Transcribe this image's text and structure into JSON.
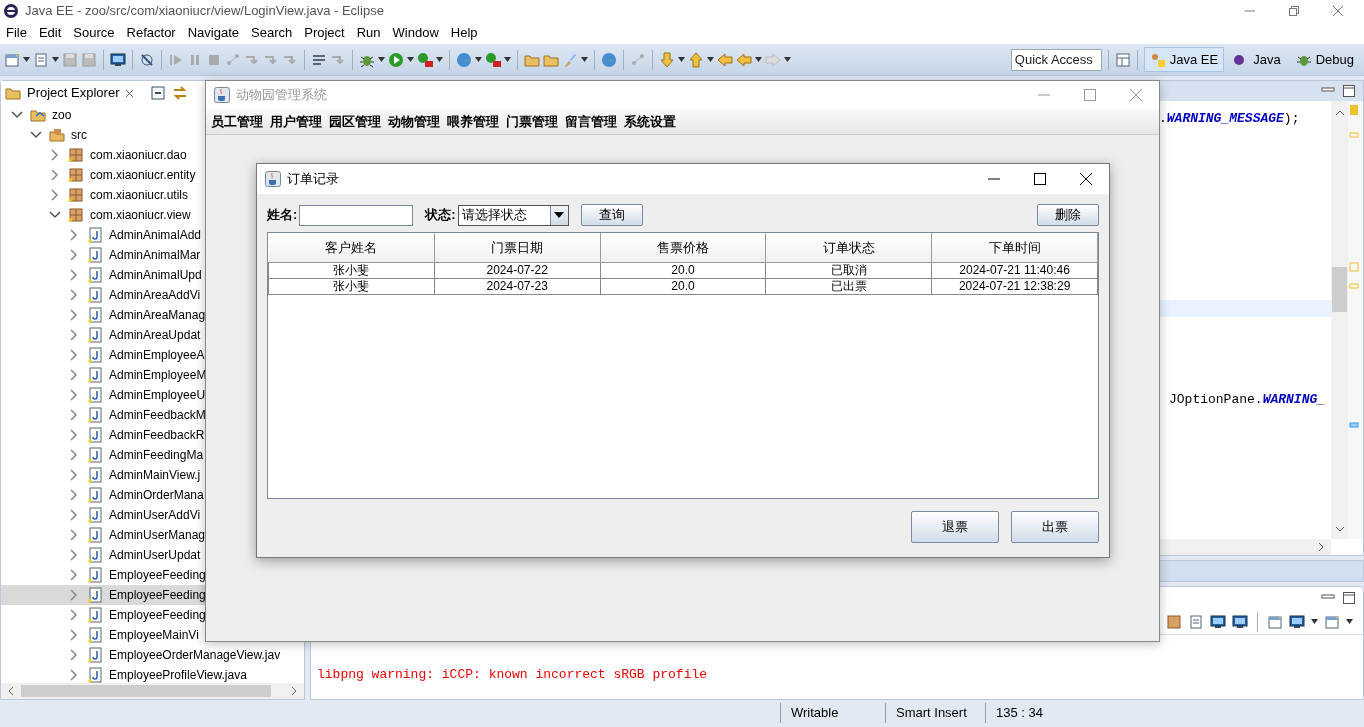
{
  "window": {
    "title": "Java EE - zoo/src/com/xiaoniucr/view/LoginView.java - Eclipse"
  },
  "menu": [
    "File",
    "Edit",
    "Source",
    "Refactor",
    "Navigate",
    "Search",
    "Project",
    "Run",
    "Window",
    "Help"
  ],
  "quick_access": {
    "placeholder": "Quick Access"
  },
  "perspectives": [
    {
      "label": "Java EE",
      "selected": true
    },
    {
      "label": "Java",
      "selected": false
    },
    {
      "label": "Debug",
      "selected": false
    }
  ],
  "project_explorer": {
    "title": "Project Explorer",
    "tree": [
      {
        "kind": "project",
        "label": "zoo",
        "expanded": true,
        "selected": false,
        "children": [
          {
            "kind": "source",
            "label": "src",
            "expanded": true,
            "selected": false,
            "children": [
              {
                "kind": "package",
                "label": "com.xiaoniucr.dao",
                "expanded": false,
                "selected": false
              },
              {
                "kind": "package",
                "label": "com.xiaoniucr.entity",
                "expanded": false,
                "selected": false
              },
              {
                "kind": "package",
                "label": "com.xiaoniucr.utils",
                "expanded": false,
                "selected": false
              },
              {
                "kind": "package",
                "label": "com.xiaoniucr.view",
                "expanded": true,
                "selected": false,
                "children": [
                  {
                    "kind": "file",
                    "label": "AdminAnimalAdd",
                    "expanded": false,
                    "selected": false
                  },
                  {
                    "kind": "file",
                    "label": "AdminAnimalMar",
                    "expanded": false,
                    "selected": false
                  },
                  {
                    "kind": "file",
                    "label": "AdminAnimalUpd",
                    "expanded": false,
                    "selected": false
                  },
                  {
                    "kind": "file",
                    "label": "AdminAreaAddVi",
                    "expanded": false,
                    "selected": false
                  },
                  {
                    "kind": "file",
                    "label": "AdminAreaManag",
                    "expanded": false,
                    "selected": false
                  },
                  {
                    "kind": "file",
                    "label": "AdminAreaUpdat",
                    "expanded": false,
                    "selected": false
                  },
                  {
                    "kind": "file",
                    "label": "AdminEmployeeA",
                    "expanded": false,
                    "selected": false
                  },
                  {
                    "kind": "file",
                    "label": "AdminEmployeeM",
                    "expanded": false,
                    "selected": false
                  },
                  {
                    "kind": "file",
                    "label": "AdminEmployeeU",
                    "expanded": false,
                    "selected": false
                  },
                  {
                    "kind": "file",
                    "label": "AdminFeedbackM",
                    "expanded": false,
                    "selected": false
                  },
                  {
                    "kind": "file",
                    "label": "AdminFeedbackR",
                    "expanded": false,
                    "selected": false
                  },
                  {
                    "kind": "file",
                    "label": "AdminFeedingMa",
                    "expanded": false,
                    "selected": false
                  },
                  {
                    "kind": "file",
                    "label": "AdminMainView.j",
                    "expanded": false,
                    "selected": false
                  },
                  {
                    "kind": "file",
                    "label": "AdminOrderMana",
                    "expanded": false,
                    "selected": false
                  },
                  {
                    "kind": "file",
                    "label": "AdminUserAddVi",
                    "expanded": false,
                    "selected": false
                  },
                  {
                    "kind": "file",
                    "label": "AdminUserManag",
                    "expanded": false,
                    "selected": false
                  },
                  {
                    "kind": "file",
                    "label": "AdminUserUpdat",
                    "expanded": false,
                    "selected": false
                  },
                  {
                    "kind": "file",
                    "label": "EmployeeFeeding",
                    "expanded": false,
                    "selected": false
                  },
                  {
                    "kind": "file",
                    "label": "EmployeeFeeding",
                    "expanded": false,
                    "selected": true
                  },
                  {
                    "kind": "file",
                    "label": "EmployeeFeeding",
                    "expanded": false,
                    "selected": false
                  },
                  {
                    "kind": "file",
                    "label": "EmployeeMainVi",
                    "expanded": false,
                    "selected": false
                  },
                  {
                    "kind": "file",
                    "label": "EmployeeOrderManageView.jav",
                    "expanded": false,
                    "selected": false
                  },
                  {
                    "kind": "file",
                    "label": "EmployeeProfileView.java",
                    "expanded": false,
                    "selected": false
                  }
                ]
              }
            ]
          }
        ]
      }
    ]
  },
  "editor": {
    "lines": [
      {
        "prefix": ".",
        "constant": "WARNING_MESSAGE",
        "suffix": ");"
      },
      {
        "prefix": "JOptionPane.",
        "constant": "WARNING_"
      }
    ]
  },
  "console": {
    "lines": [
      "libpng warning: iCCP: known incorrect sRGB profile"
    ]
  },
  "status_bar": [
    "Writable",
    "Smart Insert",
    "135 : 34"
  ],
  "app_window": {
    "title": "动物园管理系统",
    "menu": [
      "员工管理",
      "用户管理",
      "园区管理",
      "动物管理",
      "喂养管理",
      "门票管理",
      "留言管理",
      "系统设置"
    ]
  },
  "dialog": {
    "title": "订单记录",
    "name_label": "姓名:",
    "status_label": "状态:",
    "status_select": "请选择状态",
    "query_button": "查询",
    "delete_button": "删除",
    "table": {
      "columns": [
        "客户姓名",
        "门票日期",
        "售票价格",
        "订单状态",
        "下单时间"
      ],
      "rows": [
        [
          "张小斐",
          "2024-07-22",
          "20.0",
          "已取消",
          "2024-07-21 11:40:46"
        ],
        [
          "张小斐",
          "2024-07-23",
          "20.0",
          "已出票",
          "2024-07-21 12:38:29"
        ]
      ]
    },
    "buttons": [
      "退票",
      "出票"
    ]
  }
}
